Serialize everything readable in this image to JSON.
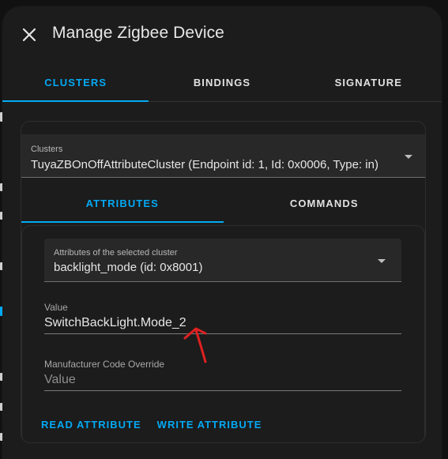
{
  "dialog": {
    "title": "Manage Zigbee Device"
  },
  "tabs": [
    {
      "label": "CLUSTERS",
      "active": true
    },
    {
      "label": "BINDINGS",
      "active": false
    },
    {
      "label": "SIGNATURE",
      "active": false
    }
  ],
  "clusters_select": {
    "label": "Clusters",
    "value": "TuyaZBOnOffAttributeCluster (Endpoint id: 1, Id: 0x0006, Type: in)"
  },
  "subtabs": [
    {
      "label": "ATTRIBUTES",
      "active": true
    },
    {
      "label": "COMMANDS",
      "active": false
    }
  ],
  "attribute_select": {
    "label": "Attributes of the selected cluster",
    "value": "backlight_mode (id: 0x8001)"
  },
  "value_field": {
    "label": "Value",
    "value": "SwitchBackLight.Mode_2"
  },
  "manufacturer_field": {
    "label": "Manufacturer Code Override",
    "placeholder": "Value"
  },
  "actions": {
    "read": "READ ATTRIBUTE",
    "write": "WRITE ATTRIBUTE"
  },
  "colors": {
    "accent": "#03a9f4",
    "surface": "#1c1c1c",
    "annotation": "#e02020"
  },
  "icons": {
    "close": "close-icon",
    "dropdown": "chevron-down-icon"
  }
}
